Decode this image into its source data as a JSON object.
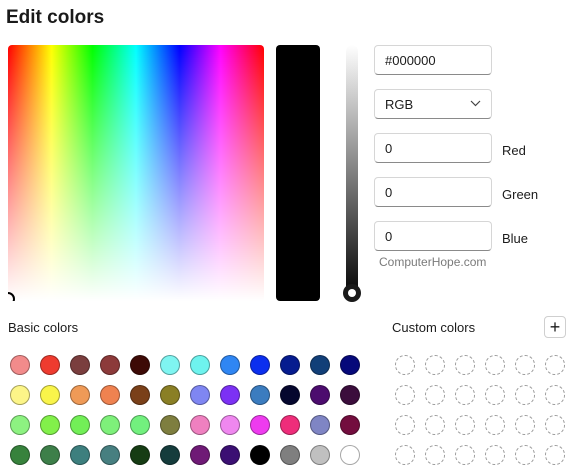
{
  "window": {
    "title": "Edit colors"
  },
  "color_value": {
    "hex": "#000000",
    "model": "RGB",
    "channels": [
      {
        "label": "Red",
        "value": "0"
      },
      {
        "label": "Green",
        "value": "0"
      },
      {
        "label": "Blue",
        "value": "0"
      }
    ],
    "brightness": 0
  },
  "watermark": "ComputerHope.com",
  "basic_colors": {
    "label": "Basic colors",
    "swatches": [
      [
        "#f28b8b",
        "#ee3b2f",
        "#7a3e3e",
        "#8c3a3a",
        "#3d0a06",
        "#7ff5f1",
        "#6ef3ee",
        "#2f86f3",
        "#0b2fef",
        "#061c8f",
        "#113f78",
        "#06097a"
      ],
      [
        "#fcf588",
        "#f9f44a",
        "#ef9a57",
        "#ef8250",
        "#7a4019",
        "#8a7f25",
        "#7f86f2",
        "#7c31f4",
        "#3b7cbf",
        "#05072e",
        "#4c0c6e",
        "#3b0d3c"
      ],
      [
        "#8df281",
        "#82f04a",
        "#72ef57",
        "#7ef07a",
        "#72f07e",
        "#7e7e3f",
        "#ef80c0",
        "#ef87ef",
        "#ee3bef",
        "#ee2d7a",
        "#7f85c4",
        "#730d3e"
      ],
      [
        "#37823c",
        "#3d7f49",
        "#3d7f7e",
        "#477f80",
        "#163c14",
        "#153c3c",
        "#6f1a76",
        "#3b0f73",
        "#000000",
        "#7f7f7f",
        "#c0c0c0",
        "#ffffff"
      ]
    ]
  },
  "custom_colors": {
    "label": "Custom colors",
    "add_label": "+",
    "rows": 4,
    "cols": 6
  }
}
